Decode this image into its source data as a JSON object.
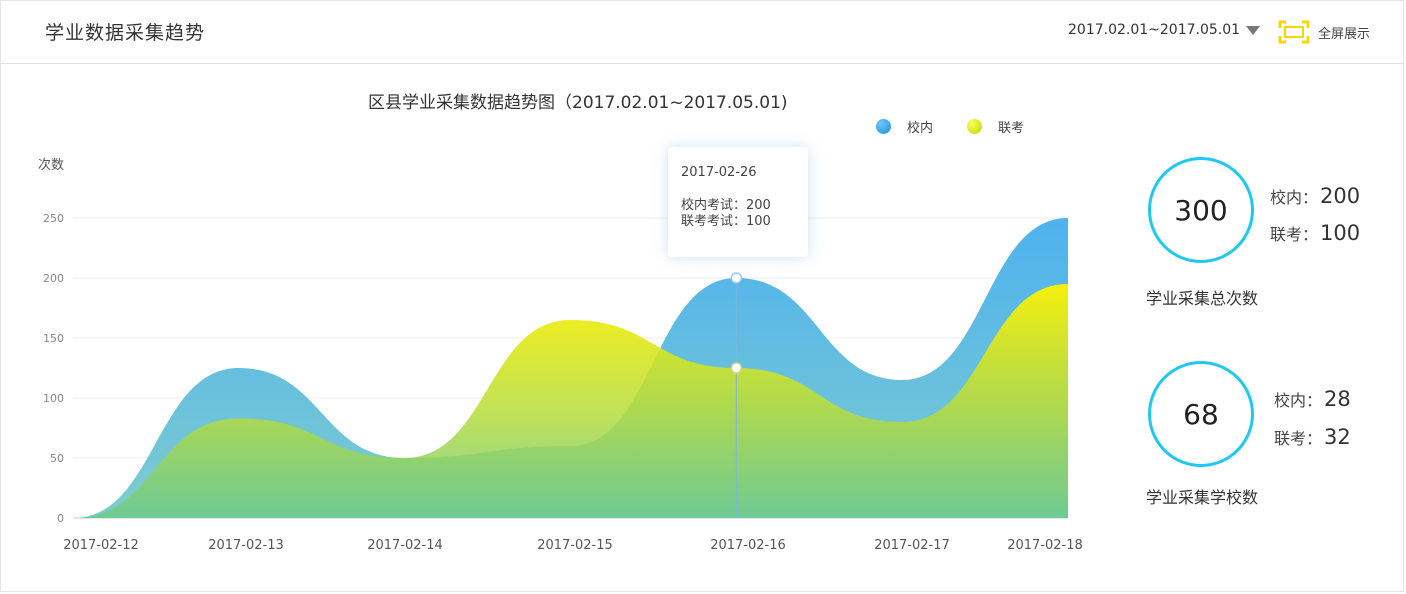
{
  "header": {
    "title": "学业数据采集趋势",
    "date_range": "2017.02.01~2017.05.01",
    "fullscreen_label": "全屏展示"
  },
  "chart_data": {
    "type": "area",
    "title": "区县学业采集数据趋势图（2017.02.01~2017.05.01)",
    "ylabel": "次数",
    "xlabel": "",
    "categories": [
      "2017-02-12",
      "2017-02-13",
      "2017-02-14",
      "2017-02-15",
      "2017-02-16",
      "2017-02-17",
      "2017-02-18"
    ],
    "y_ticks": [
      0,
      50,
      100,
      150,
      200,
      250
    ],
    "ylim": [
      0,
      250
    ],
    "grid": true,
    "legend_position": "top-right",
    "series": [
      {
        "name": "校内",
        "color": "#3aa9ee",
        "values": [
          0,
          125,
          50,
          60,
          200,
          115,
          250
        ]
      },
      {
        "name": "联考",
        "color": "#f2f000",
        "values": [
          0,
          83,
          50,
          165,
          125,
          80,
          195
        ]
      }
    ],
    "tooltip": {
      "date": "2017-02-26",
      "lines": [
        "校内考试：200",
        "联考考试：100"
      ]
    }
  },
  "stats": [
    {
      "total": "300",
      "inner_label": "校内：",
      "inner_value": "200",
      "joint_label": "联考：",
      "joint_value": "100",
      "caption": "学业采集总次数"
    },
    {
      "total": "68",
      "inner_label": "校内：",
      "inner_value": "28",
      "joint_label": "联考：",
      "joint_value": "32",
      "caption": "学业采集学校数"
    }
  ],
  "colors": {
    "accent_circle": "#1ec8f2",
    "fullscreen_icon": "#f5d800"
  }
}
